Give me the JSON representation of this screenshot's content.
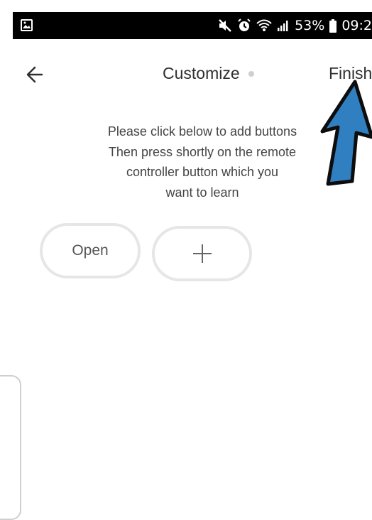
{
  "status_bar": {
    "battery_percent": "53%",
    "time": "09:2",
    "icons": [
      "gallery-icon",
      "mute-icon",
      "alarm-icon",
      "wifi-icon",
      "signal-icon",
      "battery-icon"
    ]
  },
  "header": {
    "back_icon": "arrow-left-icon",
    "title": "Customize",
    "finish_label": "Finish"
  },
  "instructions": {
    "lines": [
      "Please click below to add buttons",
      "Then press shortly on the remote",
      "controller button which you",
      "want to learn"
    ]
  },
  "buttons": {
    "open_label": "Open",
    "add_icon": "plus-icon"
  },
  "annotation": {
    "icon": "arrow-up-icon",
    "color": "#2f7fc1"
  }
}
